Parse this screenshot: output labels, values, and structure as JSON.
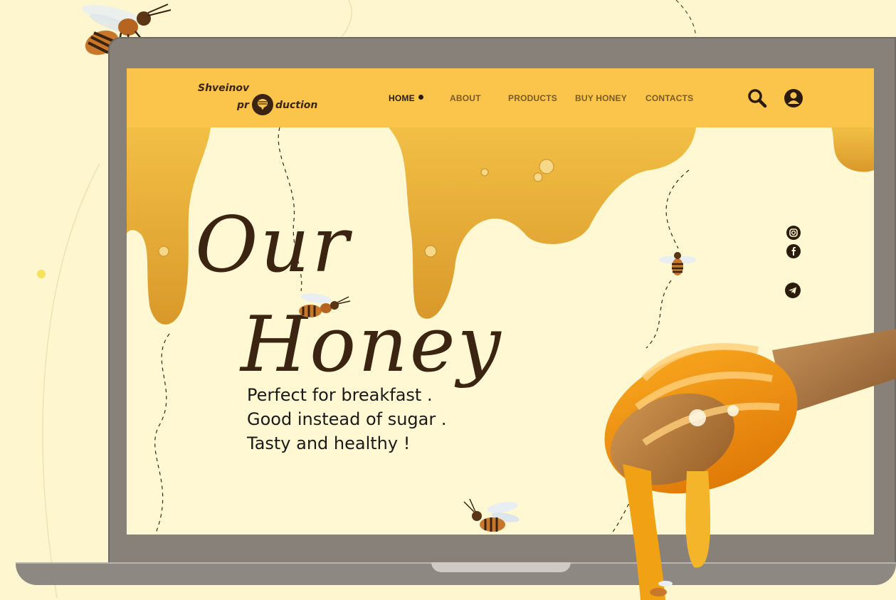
{
  "brand": {
    "line1": "Shveinov",
    "line2_left": "pr",
    "line2_right": "duction"
  },
  "nav": {
    "items": [
      {
        "label": "HOME",
        "active": true
      },
      {
        "label": "ABOUT",
        "active": false
      },
      {
        "label": "PRODUCTS",
        "active": false
      },
      {
        "label": "BUY HONEY",
        "active": false
      },
      {
        "label": "CONTACTS",
        "active": false
      }
    ]
  },
  "header_icons": [
    "search-icon",
    "user-icon"
  ],
  "hero": {
    "title_line1": "Our",
    "title_line2": "Honey",
    "taglines": [
      "Perfect for breakfast .",
      "Good instead of sugar .",
      "Tasty and healthy !"
    ]
  },
  "social_icons": [
    "instagram-icon",
    "facebook-icon",
    "telegram-icon"
  ],
  "colors": {
    "page_background": "#fdf6cf",
    "navbar": "#fac54a",
    "screen_background": "#fff8d2",
    "honey": "#e9ad33",
    "text_dark": "#3b2512",
    "laptop_frame": "#87817a"
  }
}
